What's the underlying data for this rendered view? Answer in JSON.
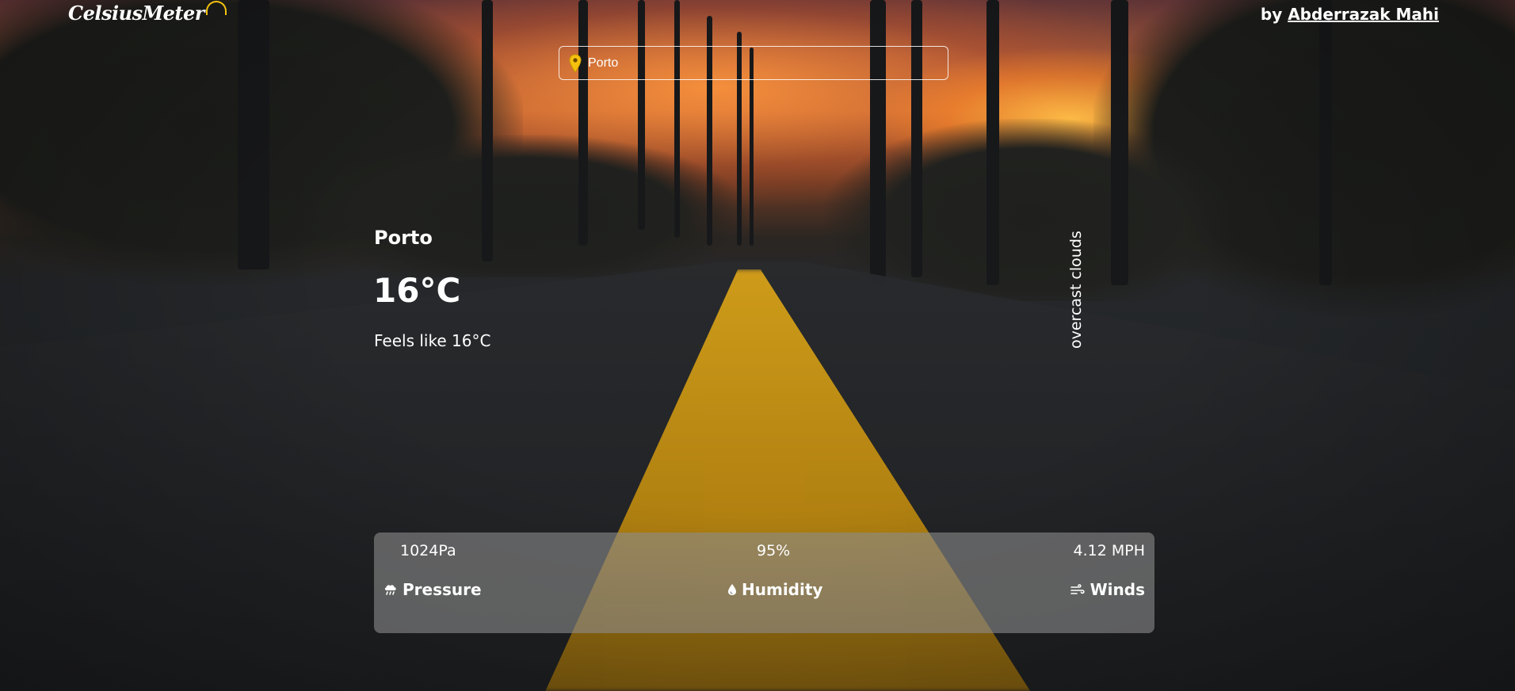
{
  "header": {
    "brand_name": "CelsiusMeter",
    "credit_prefix": "by",
    "credit_author": "Abderrazak Mahi"
  },
  "search": {
    "value": "Porto",
    "icon": "location-pin-icon"
  },
  "weather": {
    "city": "Porto",
    "temperature": "16°C",
    "feels_like": "Feels like 16°C",
    "description": "overcast clouds"
  },
  "stats": {
    "pressure": {
      "value": "1024Pa",
      "label": "Pressure",
      "icon": "cloud-rain-icon"
    },
    "humidity": {
      "value": "95%",
      "label": "Humidity",
      "icon": "droplet-icon"
    },
    "winds": {
      "value": "4.12 MPH",
      "label": "Winds",
      "icon": "wind-icon"
    }
  },
  "colors": {
    "accent": "#f5c10f",
    "panel": "rgba(140,140,140,0.6)"
  }
}
